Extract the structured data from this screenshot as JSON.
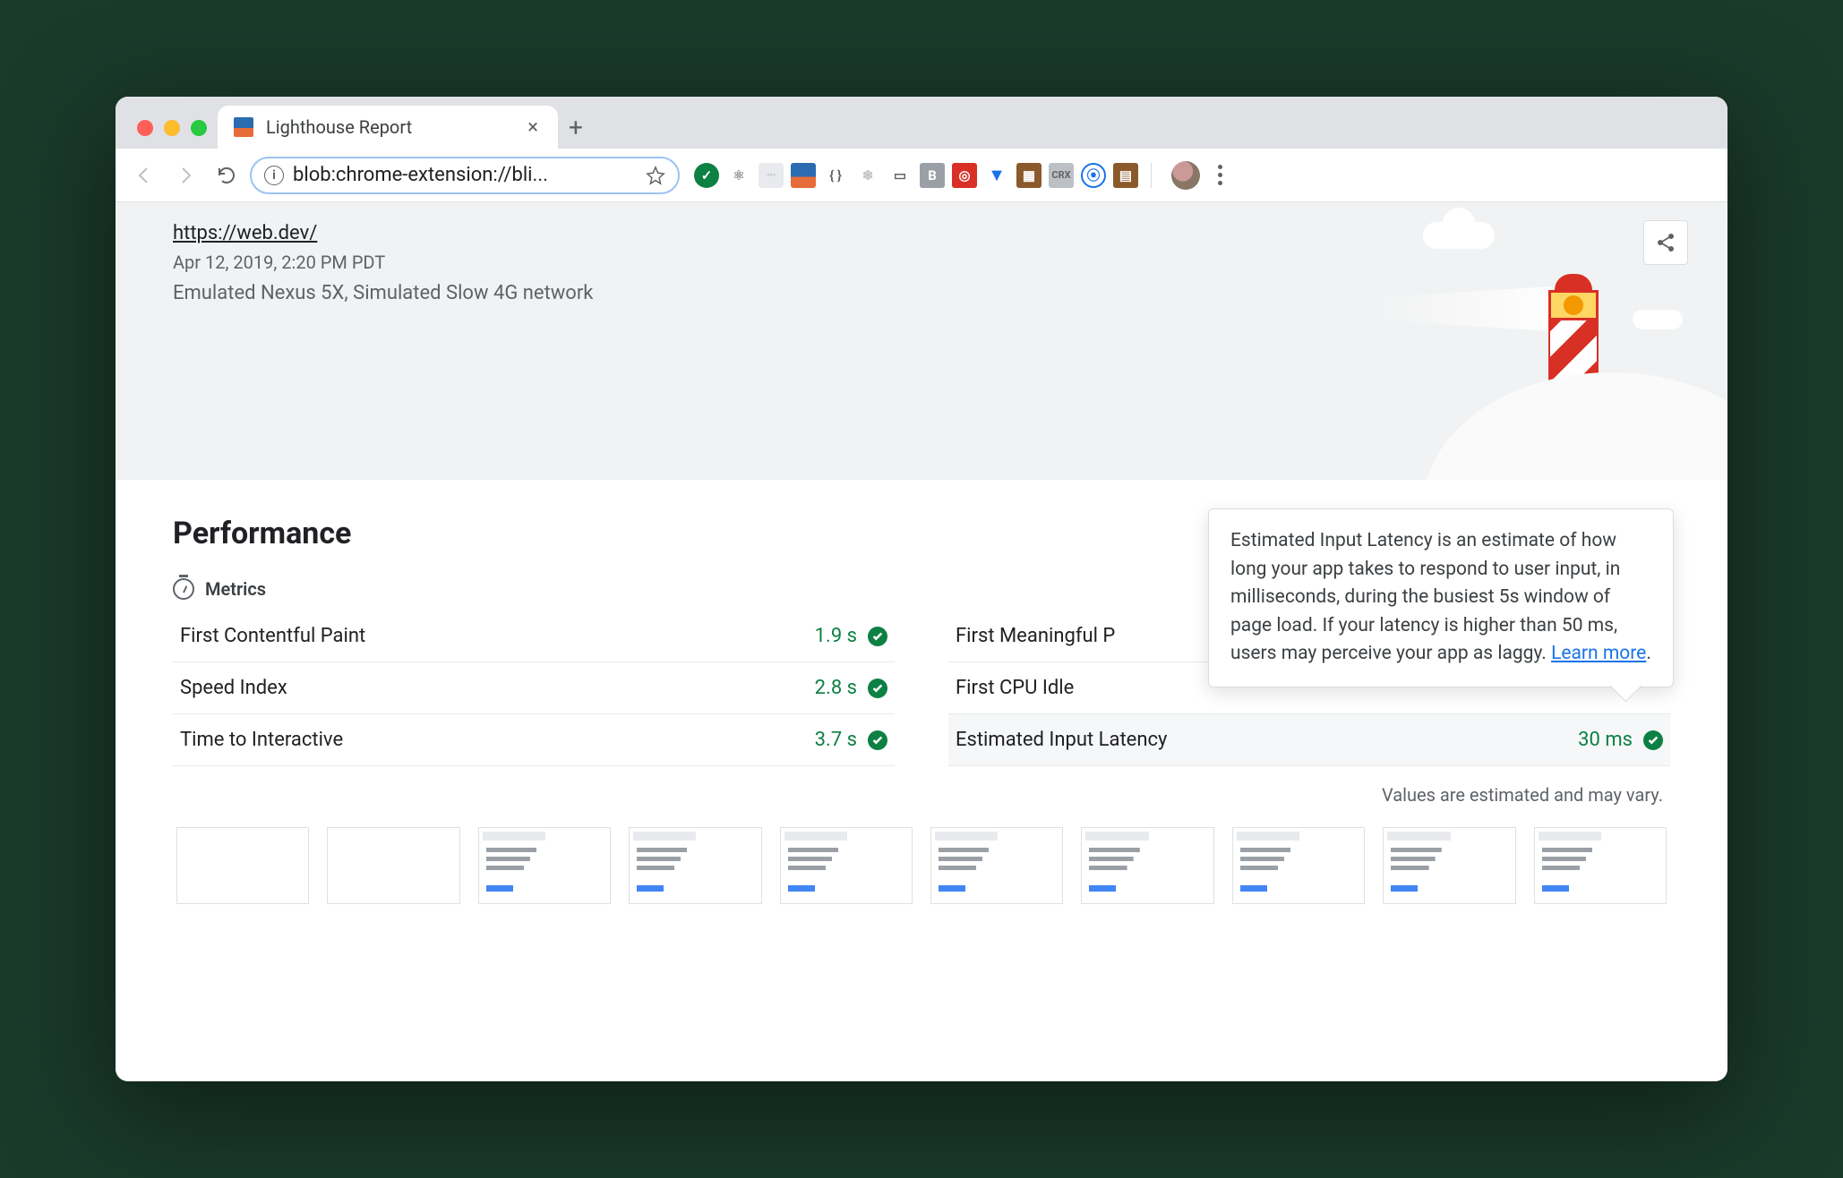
{
  "tab": {
    "title": "Lighthouse Report"
  },
  "address_bar": {
    "url": "blob:chrome-extension://bli..."
  },
  "report": {
    "url": "https://web.dev/",
    "date": "Apr 12, 2019, 2:20 PM PDT",
    "environment": "Emulated Nexus 5X, Simulated Slow 4G network"
  },
  "section": {
    "title": "Performance",
    "metrics_label": "Metrics",
    "note": "Values are estimated and may vary."
  },
  "metrics": {
    "left": [
      {
        "name": "First Contentful Paint",
        "value": "1.9 s"
      },
      {
        "name": "Speed Index",
        "value": "2.8 s"
      },
      {
        "name": "Time to Interactive",
        "value": "3.7 s"
      }
    ],
    "right": [
      {
        "name": "First Meaningful P",
        "value": ""
      },
      {
        "name": "First CPU Idle",
        "value": ""
      },
      {
        "name": "Estimated Input Latency",
        "value": "30 ms"
      }
    ]
  },
  "tooltip": {
    "text": "Estimated Input Latency is an estimate of how long your app takes to respond to user input, in milliseconds, during the busiest 5s window of page load. If your latency is higher than 50 ms, users may perceive your app as laggy. ",
    "link": "Learn more"
  }
}
